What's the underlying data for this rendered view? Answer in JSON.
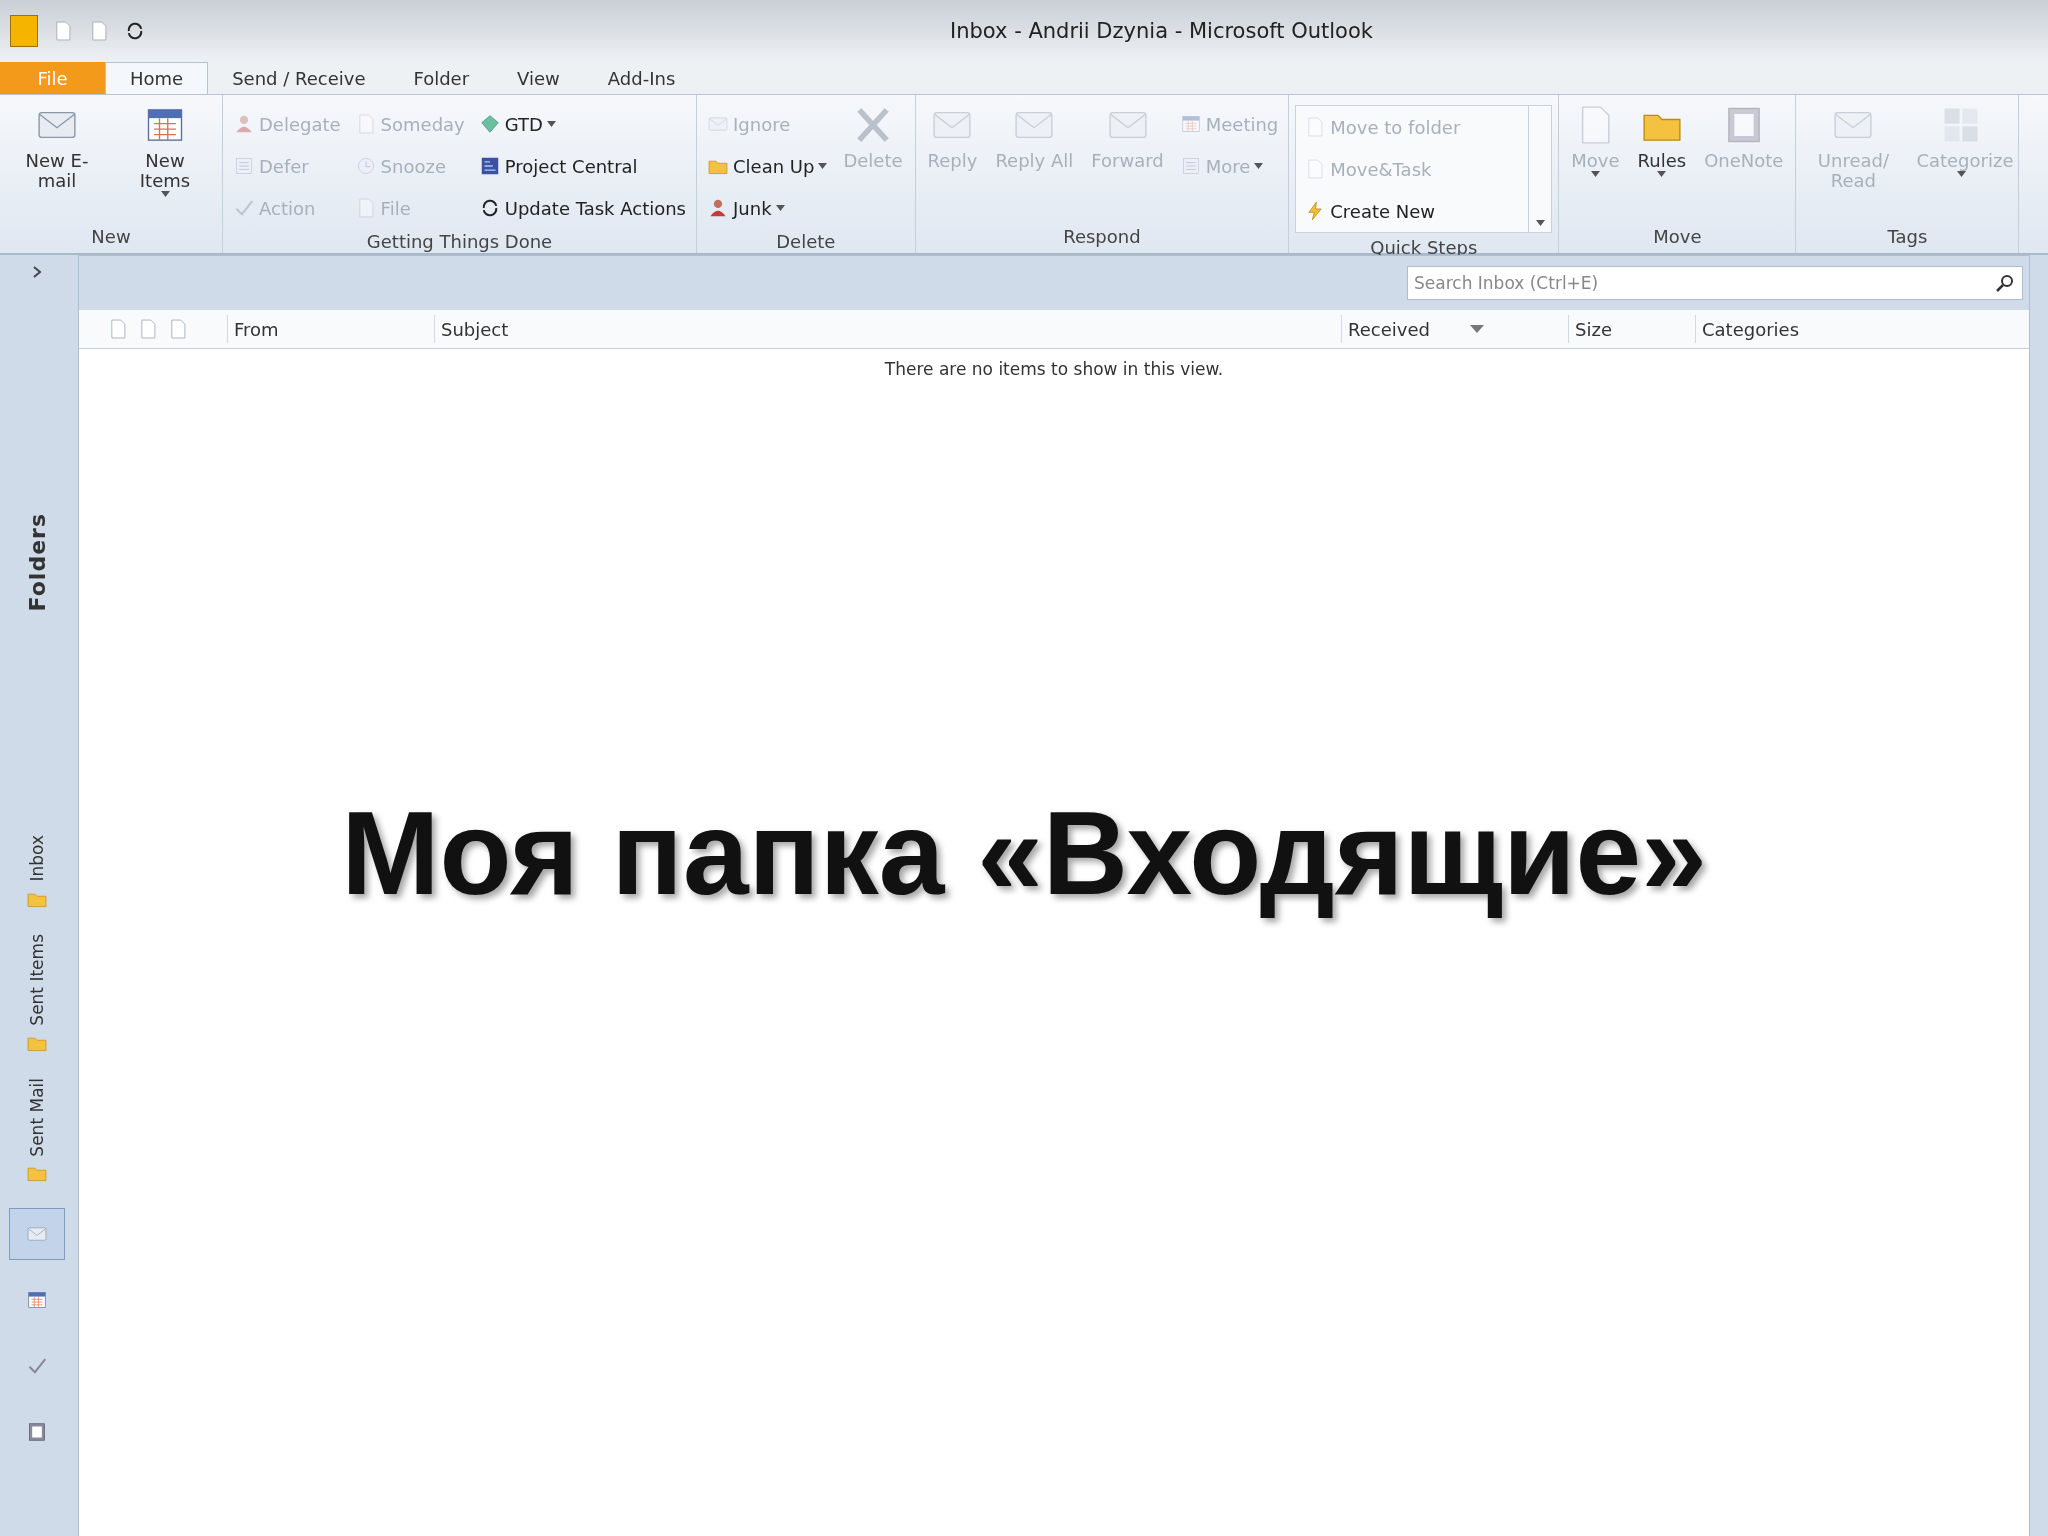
{
  "window": {
    "title": "Inbox - Andrii Dzynia - Microsoft Outlook"
  },
  "tabs": [
    {
      "label": "File",
      "kind": "file",
      "selected": false
    },
    {
      "label": "Home",
      "kind": "tab",
      "selected": true
    },
    {
      "label": "Send / Receive",
      "kind": "tab",
      "selected": false
    },
    {
      "label": "Folder",
      "kind": "tab",
      "selected": false
    },
    {
      "label": "View",
      "kind": "tab",
      "selected": false
    },
    {
      "label": "Add-Ins",
      "kind": "tab",
      "selected": false
    }
  ],
  "ribbon": {
    "groups": [
      {
        "label": "New",
        "items": [
          {
            "label": "New E-mail",
            "kind": "large",
            "disabled": false,
            "dropdown": false
          },
          {
            "label": "New Items",
            "kind": "large",
            "disabled": false,
            "dropdown": true
          }
        ]
      },
      {
        "label": "Getting Things Done",
        "items": [
          {
            "label": "Delegate",
            "kind": "small",
            "disabled": true,
            "dropdown": false
          },
          {
            "label": "Defer",
            "kind": "small",
            "disabled": true,
            "dropdown": false
          },
          {
            "label": "Action",
            "kind": "small",
            "disabled": true,
            "dropdown": false
          },
          {
            "label": "Someday",
            "kind": "small",
            "disabled": true,
            "dropdown": false
          },
          {
            "label": "Snooze",
            "kind": "small",
            "disabled": true,
            "dropdown": false
          },
          {
            "label": "File",
            "kind": "small",
            "disabled": true,
            "dropdown": false
          },
          {
            "label": "GTD",
            "kind": "small",
            "disabled": false,
            "dropdown": true
          },
          {
            "label": "Project Central",
            "kind": "small",
            "disabled": false,
            "dropdown": false
          },
          {
            "label": "Update Task Actions",
            "kind": "small",
            "disabled": false,
            "dropdown": false
          }
        ]
      },
      {
        "label": "Delete",
        "items": [
          {
            "label": "Ignore",
            "kind": "small",
            "disabled": true,
            "dropdown": false
          },
          {
            "label": "Clean Up",
            "kind": "small",
            "disabled": false,
            "dropdown": true
          },
          {
            "label": "Junk",
            "kind": "small",
            "disabled": false,
            "dropdown": true
          },
          {
            "label": "Delete",
            "kind": "large",
            "disabled": true,
            "dropdown": false
          }
        ]
      },
      {
        "label": "Respond",
        "items": [
          {
            "label": "Reply",
            "kind": "large",
            "disabled": true,
            "dropdown": false
          },
          {
            "label": "Reply All",
            "kind": "large",
            "disabled": true,
            "dropdown": false
          },
          {
            "label": "Forward",
            "kind": "large",
            "disabled": true,
            "dropdown": false
          },
          {
            "label": "Meeting",
            "kind": "small",
            "disabled": true,
            "dropdown": false
          },
          {
            "label": "More",
            "kind": "small",
            "disabled": true,
            "dropdown": true
          }
        ]
      },
      {
        "label": "Quick Steps",
        "items": [
          {
            "label": "Move to folder",
            "kind": "step",
            "disabled": true,
            "dropdown": false
          },
          {
            "label": "Move&Task",
            "kind": "step",
            "disabled": true,
            "dropdown": false
          },
          {
            "label": "Create New",
            "kind": "step",
            "disabled": false,
            "dropdown": false
          }
        ]
      },
      {
        "label": "Move",
        "items": [
          {
            "label": "Move",
            "kind": "large",
            "disabled": true,
            "dropdown": true
          },
          {
            "label": "Rules",
            "kind": "large",
            "disabled": false,
            "dropdown": true
          },
          {
            "label": "OneNote",
            "kind": "large",
            "disabled": true,
            "dropdown": false
          }
        ]
      },
      {
        "label": "Tags",
        "items": [
          {
            "label": "Unread/ Read",
            "kind": "large",
            "disabled": true,
            "dropdown": false
          },
          {
            "label": "Categorize",
            "kind": "large",
            "disabled": true,
            "dropdown": true
          }
        ]
      }
    ]
  },
  "sidebar": {
    "title": "Folders",
    "favorites": [
      {
        "label": "Inbox"
      },
      {
        "label": "Sent Items"
      },
      {
        "label": "Sent Mail"
      }
    ],
    "navigation": [
      {
        "selected": true
      },
      {
        "selected": false
      },
      {
        "selected": false
      },
      {
        "selected": false
      }
    ]
  },
  "search": {
    "placeholder": "Search Inbox (Ctrl+E)"
  },
  "columns": [
    {
      "label": "From",
      "sorted": false
    },
    {
      "label": "Subject",
      "sorted": false
    },
    {
      "label": "Received",
      "sorted": true
    },
    {
      "label": "Size",
      "sorted": false
    },
    {
      "label": "Categories",
      "sorted": false
    }
  ],
  "empty_message": "There are no items to show in this view.",
  "overlay_caption": "Моя папка «Входящие»"
}
